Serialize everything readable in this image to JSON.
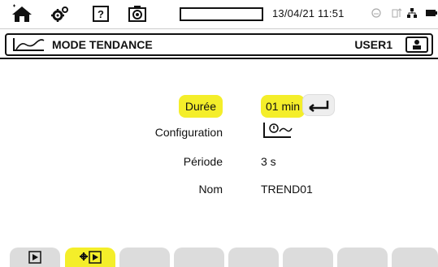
{
  "status_bar": {
    "datetime": "13/04/21 11:51",
    "icons": [
      "home-icon",
      "settings-icon",
      "help-icon",
      "camera-icon",
      "progress-bar",
      "status-indicator-icon",
      "usb-icon",
      "network-icon",
      "battery-icon"
    ]
  },
  "header": {
    "title": "MODE TENDANCE",
    "user": "USER1",
    "icons": [
      "trend-mode-icon",
      "user-icon"
    ]
  },
  "form": {
    "duration": {
      "label": "Durée",
      "value": "01 min"
    },
    "configuration": {
      "label": "Configuration",
      "value_icon": "trend-configuration-icon"
    },
    "period": {
      "label": "Période",
      "value": "3 s"
    },
    "name": {
      "label": "Nom",
      "value": "TREND01"
    }
  },
  "tabs": [
    {
      "icon": "play-icon",
      "active": false
    },
    {
      "icon": "trend-config-play-icon",
      "active": true
    },
    {
      "icon": "",
      "active": false
    },
    {
      "icon": "",
      "active": false
    },
    {
      "icon": "",
      "active": false
    },
    {
      "icon": "",
      "active": false
    },
    {
      "icon": "",
      "active": false
    },
    {
      "icon": "",
      "active": false
    }
  ],
  "colors": {
    "highlight": "#f4ee2a",
    "tab": "#dcdcdc"
  }
}
